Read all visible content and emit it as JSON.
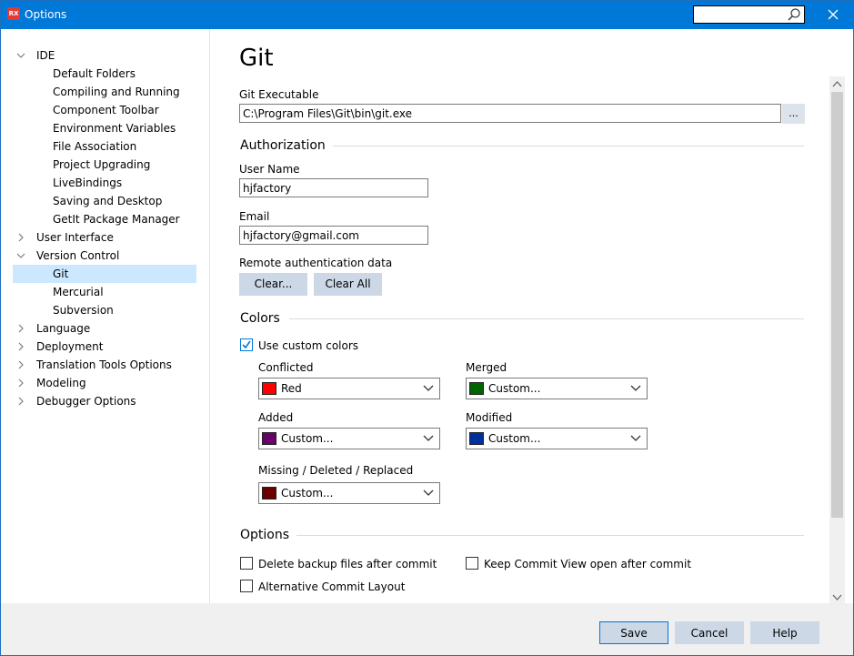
{
  "window": {
    "title": "Options",
    "app_icon_text": "RX",
    "search_value": "",
    "accent_color": "#0078d7"
  },
  "tree": {
    "items": [
      {
        "label": "IDE",
        "level": 0,
        "expanded": true
      },
      {
        "label": "Default Folders",
        "level": 1
      },
      {
        "label": "Compiling and Running",
        "level": 1
      },
      {
        "label": "Component Toolbar",
        "level": 1
      },
      {
        "label": "Environment Variables",
        "level": 1
      },
      {
        "label": "File Association",
        "level": 1
      },
      {
        "label": "Project Upgrading",
        "level": 1
      },
      {
        "label": "LiveBindings",
        "level": 1
      },
      {
        "label": "Saving and Desktop",
        "level": 1
      },
      {
        "label": "GetIt Package Manager",
        "level": 1
      },
      {
        "label": "User Interface",
        "level": 0,
        "expanded": false
      },
      {
        "label": "Version Control",
        "level": 0,
        "expanded": true
      },
      {
        "label": "Git",
        "level": 1,
        "selected": true
      },
      {
        "label": "Mercurial",
        "level": 1
      },
      {
        "label": "Subversion",
        "level": 1
      },
      {
        "label": "Language",
        "level": 0,
        "expanded": false
      },
      {
        "label": "Deployment",
        "level": 0,
        "expanded": false
      },
      {
        "label": "Translation Tools Options",
        "level": 0,
        "expanded": false
      },
      {
        "label": "Modeling",
        "level": 0,
        "expanded": false
      },
      {
        "label": "Debugger Options",
        "level": 0,
        "expanded": false
      }
    ]
  },
  "page": {
    "title": "Git",
    "executable": {
      "label": "Git Executable",
      "value": "C:\\Program Files\\Git\\bin\\git.exe",
      "browse_label": "..."
    },
    "authorization": {
      "heading": "Authorization",
      "user_name_label": "User Name",
      "user_name_value": "hjfactory",
      "email_label": "Email",
      "email_value": "hjfactory@gmail.com",
      "remote_label": "Remote authentication data",
      "clear_button": "Clear...",
      "clear_all_button": "Clear All"
    },
    "colors": {
      "heading": "Colors",
      "use_custom_label": "Use custom colors",
      "use_custom_checked": true,
      "conflicted": {
        "label": "Conflicted",
        "value": "Red",
        "swatch": "#ff0000"
      },
      "merged": {
        "label": "Merged",
        "value": "Custom...",
        "swatch": "#006400"
      },
      "added": {
        "label": "Added",
        "value": "Custom...",
        "swatch": "#6b006b"
      },
      "modified": {
        "label": "Modified",
        "value": "Custom...",
        "swatch": "#0030a0"
      },
      "missing": {
        "label": "Missing / Deleted / Replaced",
        "value": "Custom...",
        "swatch": "#6b0000"
      }
    },
    "options": {
      "heading": "Options",
      "delete_backup_label": "Delete backup files after commit",
      "delete_backup_checked": false,
      "keep_commit_label": "Keep Commit View open after commit",
      "keep_commit_checked": false,
      "alt_layout_label": "Alternative Commit Layout",
      "alt_layout_checked": false
    }
  },
  "footer": {
    "save": "Save",
    "cancel": "Cancel",
    "help": "Help"
  }
}
